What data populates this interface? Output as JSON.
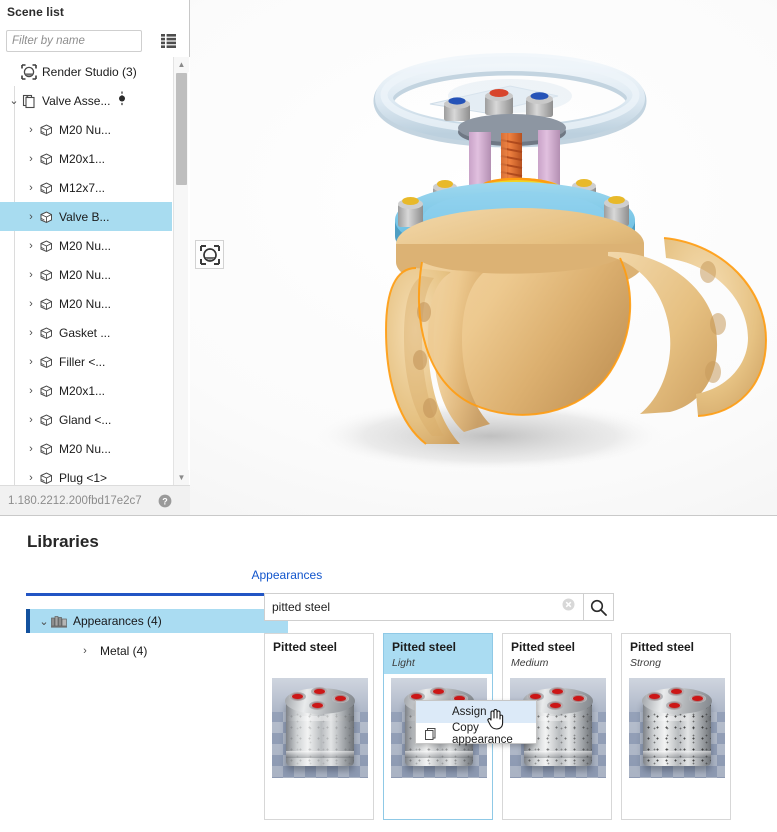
{
  "scene_panel": {
    "title": "Scene list",
    "filter_placeholder": "Filter by name",
    "filter_value": "",
    "list_mode_icon": "list-view-icon",
    "version": "1.180.2212.200fbd17e2c7",
    "help_icon": "help-icon",
    "tree": [
      {
        "label": "Render Studio (3)",
        "icon": "render-studio-icon",
        "depth": 0,
        "caret": "",
        "selected": false,
        "pin": false
      },
      {
        "label": "Valve Asse...",
        "icon": "assembly-icon",
        "depth": 0,
        "caret": "⌄",
        "selected": false,
        "pin": true
      },
      {
        "label": "M20 Nu...",
        "icon": "part-icon",
        "depth": 1,
        "caret": "›",
        "selected": false,
        "pin": false
      },
      {
        "label": "M20x1...",
        "icon": "part-icon",
        "depth": 1,
        "caret": "›",
        "selected": false,
        "pin": false
      },
      {
        "label": "M12x7...",
        "icon": "part-icon",
        "depth": 1,
        "caret": "›",
        "selected": false,
        "pin": false
      },
      {
        "label": "Valve B...",
        "icon": "part-icon",
        "depth": 1,
        "caret": "›",
        "selected": true,
        "pin": false
      },
      {
        "label": "M20 Nu...",
        "icon": "part-icon",
        "depth": 1,
        "caret": "›",
        "selected": false,
        "pin": false
      },
      {
        "label": "M20 Nu...",
        "icon": "part-icon",
        "depth": 1,
        "caret": "›",
        "selected": false,
        "pin": false
      },
      {
        "label": "M20 Nu...",
        "icon": "part-icon",
        "depth": 1,
        "caret": "›",
        "selected": false,
        "pin": false
      },
      {
        "label": "Gasket ...",
        "icon": "part-icon",
        "depth": 1,
        "caret": "›",
        "selected": false,
        "pin": false
      },
      {
        "label": "Filler <...",
        "icon": "part-icon",
        "depth": 1,
        "caret": "›",
        "selected": false,
        "pin": false
      },
      {
        "label": "M20x1...",
        "icon": "part-icon",
        "depth": 1,
        "caret": "›",
        "selected": false,
        "pin": false
      },
      {
        "label": "Gland <...",
        "icon": "part-icon",
        "depth": 1,
        "caret": "›",
        "selected": false,
        "pin": false
      },
      {
        "label": "M20 Nu...",
        "icon": "part-icon",
        "depth": 1,
        "caret": "›",
        "selected": false,
        "pin": false
      },
      {
        "label": "Plug <1>",
        "icon": "part-icon",
        "depth": 1,
        "caret": "›",
        "selected": false,
        "pin": false
      }
    ]
  },
  "viewport": {
    "badge_icon": "render-studio-badge-icon",
    "model_name": "Valve Assembly",
    "colors": {
      "handwheel": "#dce8f2",
      "yoke_column": "#d6b4d4",
      "stem": "#e06a2b",
      "gland": "#e8c319",
      "bonnet_flange": "#7ec8e8",
      "body": "#e9c184",
      "bolt_grey": "#b8b8b8",
      "bolt_yellow": "#e8b92a",
      "selection_outline": "#ff9900",
      "background": "#ffffff"
    }
  },
  "libraries": {
    "title": "Libraries",
    "tabs": [
      {
        "label": "Appearances",
        "active": true
      }
    ],
    "tree": {
      "root": {
        "label": "Appearances (4)",
        "icon": "library-icon",
        "caret": "⌄",
        "selected": true
      },
      "child": {
        "label": "Metal (4)",
        "caret": "›",
        "selected": false
      }
    },
    "search": {
      "value": "pitted steel",
      "placeholder": "",
      "clear_icon": "clear-icon",
      "search_icon": "search-icon"
    },
    "cards": [
      {
        "name": "Pitted steel",
        "variant": "",
        "selected": false,
        "class": "plain"
      },
      {
        "name": "Pitted steel",
        "variant": "Light",
        "selected": true,
        "class": "light"
      },
      {
        "name": "Pitted steel",
        "variant": "Medium",
        "selected": false,
        "class": "medium"
      },
      {
        "name": "Pitted steel",
        "variant": "Strong",
        "selected": false,
        "class": "strong"
      }
    ],
    "context_menu": [
      {
        "label": "Assign",
        "icon": "",
        "highlighted": true
      },
      {
        "label": "Copy appearance",
        "icon": "copy-icon",
        "highlighted": false
      }
    ]
  },
  "colors": {
    "accent_blue": "#2255c4",
    "link_blue": "#1155cc",
    "selection_blue": "#aadcf2",
    "menu_highlight": "#dceaf8"
  }
}
